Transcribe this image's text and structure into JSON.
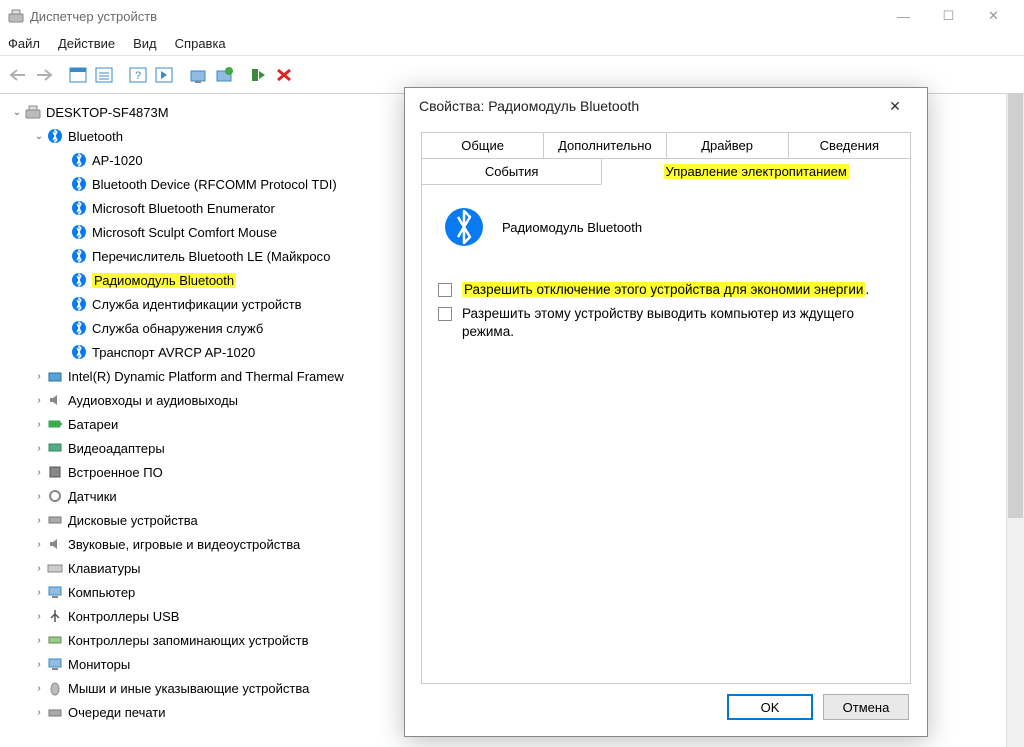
{
  "window": {
    "title": "Диспетчер устройств"
  },
  "window_controls": {
    "minimize": "—",
    "maximize": "☐",
    "close": "✕"
  },
  "menu": {
    "file": "Файл",
    "action": "Действие",
    "view": "Вид",
    "help": "Справка"
  },
  "tree": {
    "root": "DESKTOP-SF4873M",
    "bluetooth": "Bluetooth",
    "bt_items": [
      "AP-1020",
      "Bluetooth Device (RFCOMM Protocol TDI)",
      "Microsoft Bluetooth Enumerator",
      "Microsoft Sculpt Comfort Mouse",
      "Перечислитель Bluetooth LE (Майкросо",
      "Радиомодуль Bluetooth",
      "Служба идентификации устройств",
      "Служба обнаружения служб",
      "Транспорт AVRCP AP-1020"
    ],
    "categories": [
      "Intel(R) Dynamic Platform and Thermal Framew",
      "Аудиовходы и аудиовыходы",
      "Батареи",
      "Видеоадаптеры",
      "Встроенное ПО",
      "Датчики",
      "Дисковые устройства",
      "Звуковые, игровые и видеоустройства",
      "Клавиатуры",
      "Компьютер",
      "Контроллеры USB",
      "Контроллеры запоминающих устройств",
      "Мониторы",
      "Мыши и иные указывающие устройства",
      "Очереди печати"
    ]
  },
  "dialog": {
    "title": "Свойства: Радиомодуль Bluetooth",
    "tabs": {
      "general": "Общие",
      "advanced": "Дополнительно",
      "driver": "Драйвер",
      "details": "Сведения",
      "events": "События",
      "power": "Управление электропитанием"
    },
    "device_name": "Радиомодуль Bluetooth",
    "check1": "Разрешить отключение этого устройства для экономии энергии",
    "check1_tail": ".",
    "check2": "Разрешить этому устройству выводить компьютер из ждущего режима.",
    "ok": "OK",
    "cancel": "Отмена"
  }
}
